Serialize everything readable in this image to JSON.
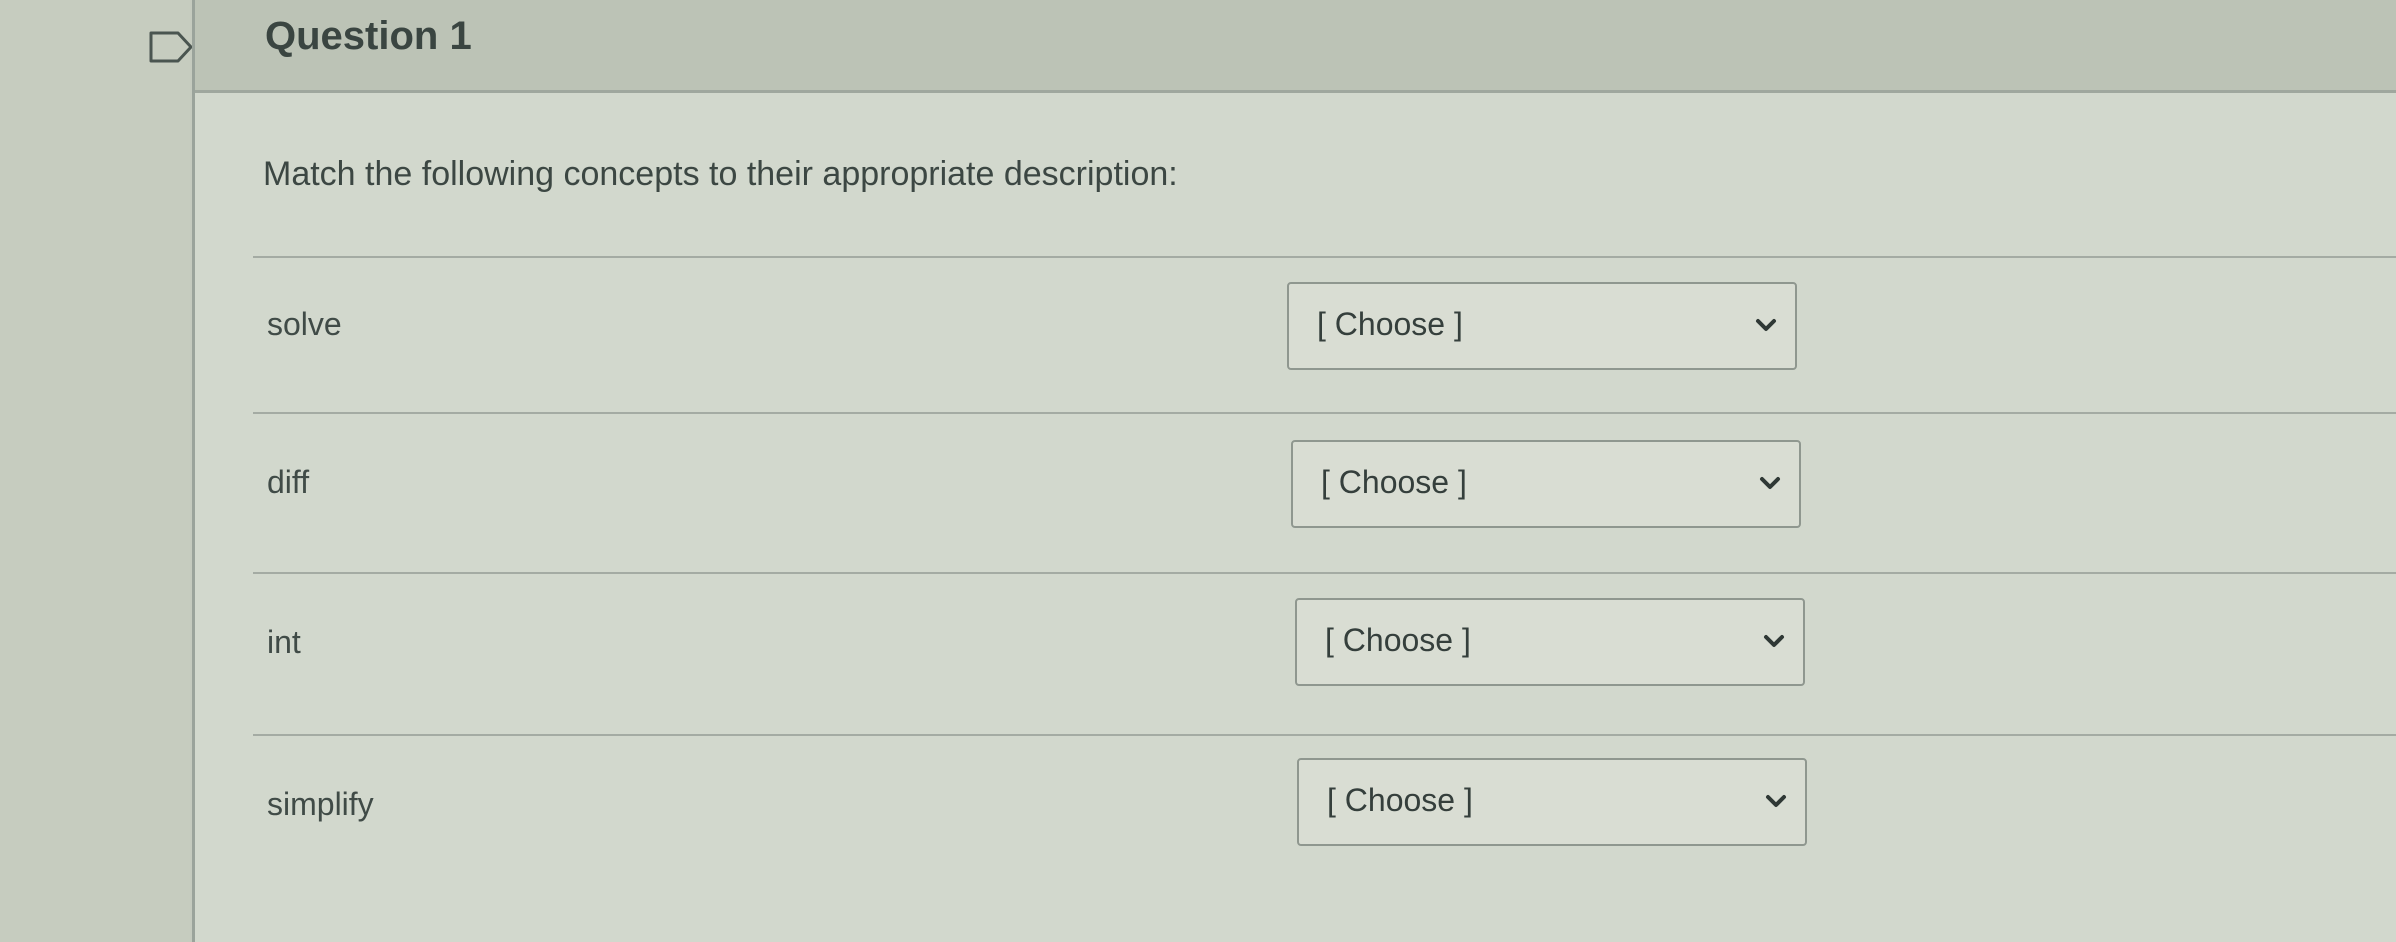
{
  "question": {
    "title": "Question 1",
    "prompt": "Match the following concepts to their appropriate description:"
  },
  "icons": {
    "flag": "flag-icon",
    "dropdown": "chevron-down-icon"
  },
  "rows": [
    {
      "label": "solve",
      "selected": "[ Choose ]"
    },
    {
      "label": "diff",
      "selected": "[ Choose ]"
    },
    {
      "label": "int",
      "selected": "[ Choose ]"
    },
    {
      "label": "simplify",
      "selected": "[ Choose ]"
    }
  ]
}
